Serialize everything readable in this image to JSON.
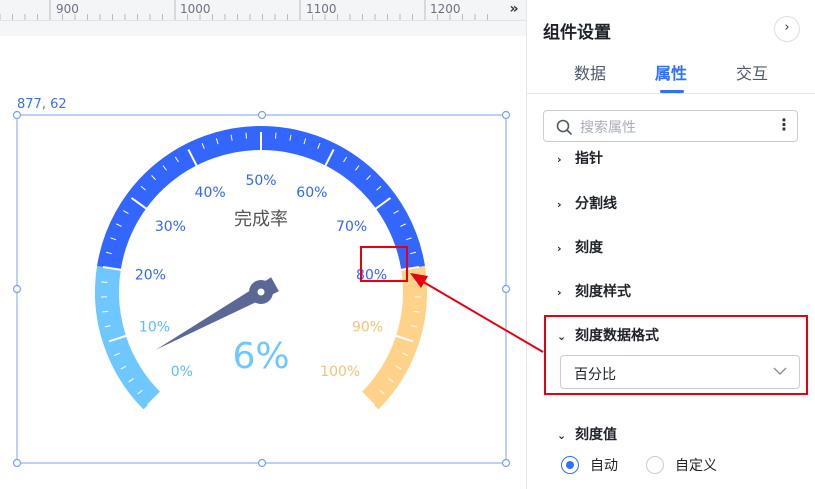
{
  "ruler": {
    "ticks": [
      "900",
      "1000",
      "1100",
      "1200"
    ],
    "more_icon": "double-chevron-right-icon"
  },
  "selection": {
    "coordinates": "877, 62"
  },
  "gauge": {
    "title": "完成率",
    "value": "6%",
    "value_fraction": 0.06,
    "scale_labels": [
      "0%",
      "10%",
      "20%",
      "30%",
      "40%",
      "50%",
      "60%",
      "70%",
      "80%",
      "90%",
      "100%"
    ],
    "colors": {
      "low": "#6ec8ff",
      "mid": "#3366ff",
      "high": "#ffd28a",
      "pointer": "#5b6896",
      "label_low": "#5cbcf5",
      "label_mid": "#3366ff",
      "label_high": "#f5c27a"
    }
  },
  "panel": {
    "title": "组件设置",
    "next_icon": "chevron-right-icon",
    "tabs": [
      {
        "label": "数据"
      },
      {
        "label": "属性",
        "active": true
      },
      {
        "label": "交互"
      }
    ],
    "search": {
      "placeholder": "搜索属性"
    },
    "sections": [
      {
        "label": "指针",
        "expanded": false
      },
      {
        "label": "分割线",
        "expanded": false
      },
      {
        "label": "刻度",
        "expanded": false
      },
      {
        "label": "刻度样式",
        "expanded": false
      },
      {
        "label": "刻度数据格式",
        "expanded": true
      },
      {
        "label": "刻度值",
        "expanded": true
      }
    ],
    "format_select": {
      "value": "百分比"
    },
    "scale_value_options": [
      {
        "label": "自动",
        "selected": true
      },
      {
        "label": "自定义",
        "selected": false
      }
    ]
  },
  "annotation": {
    "color": "#e60012"
  }
}
